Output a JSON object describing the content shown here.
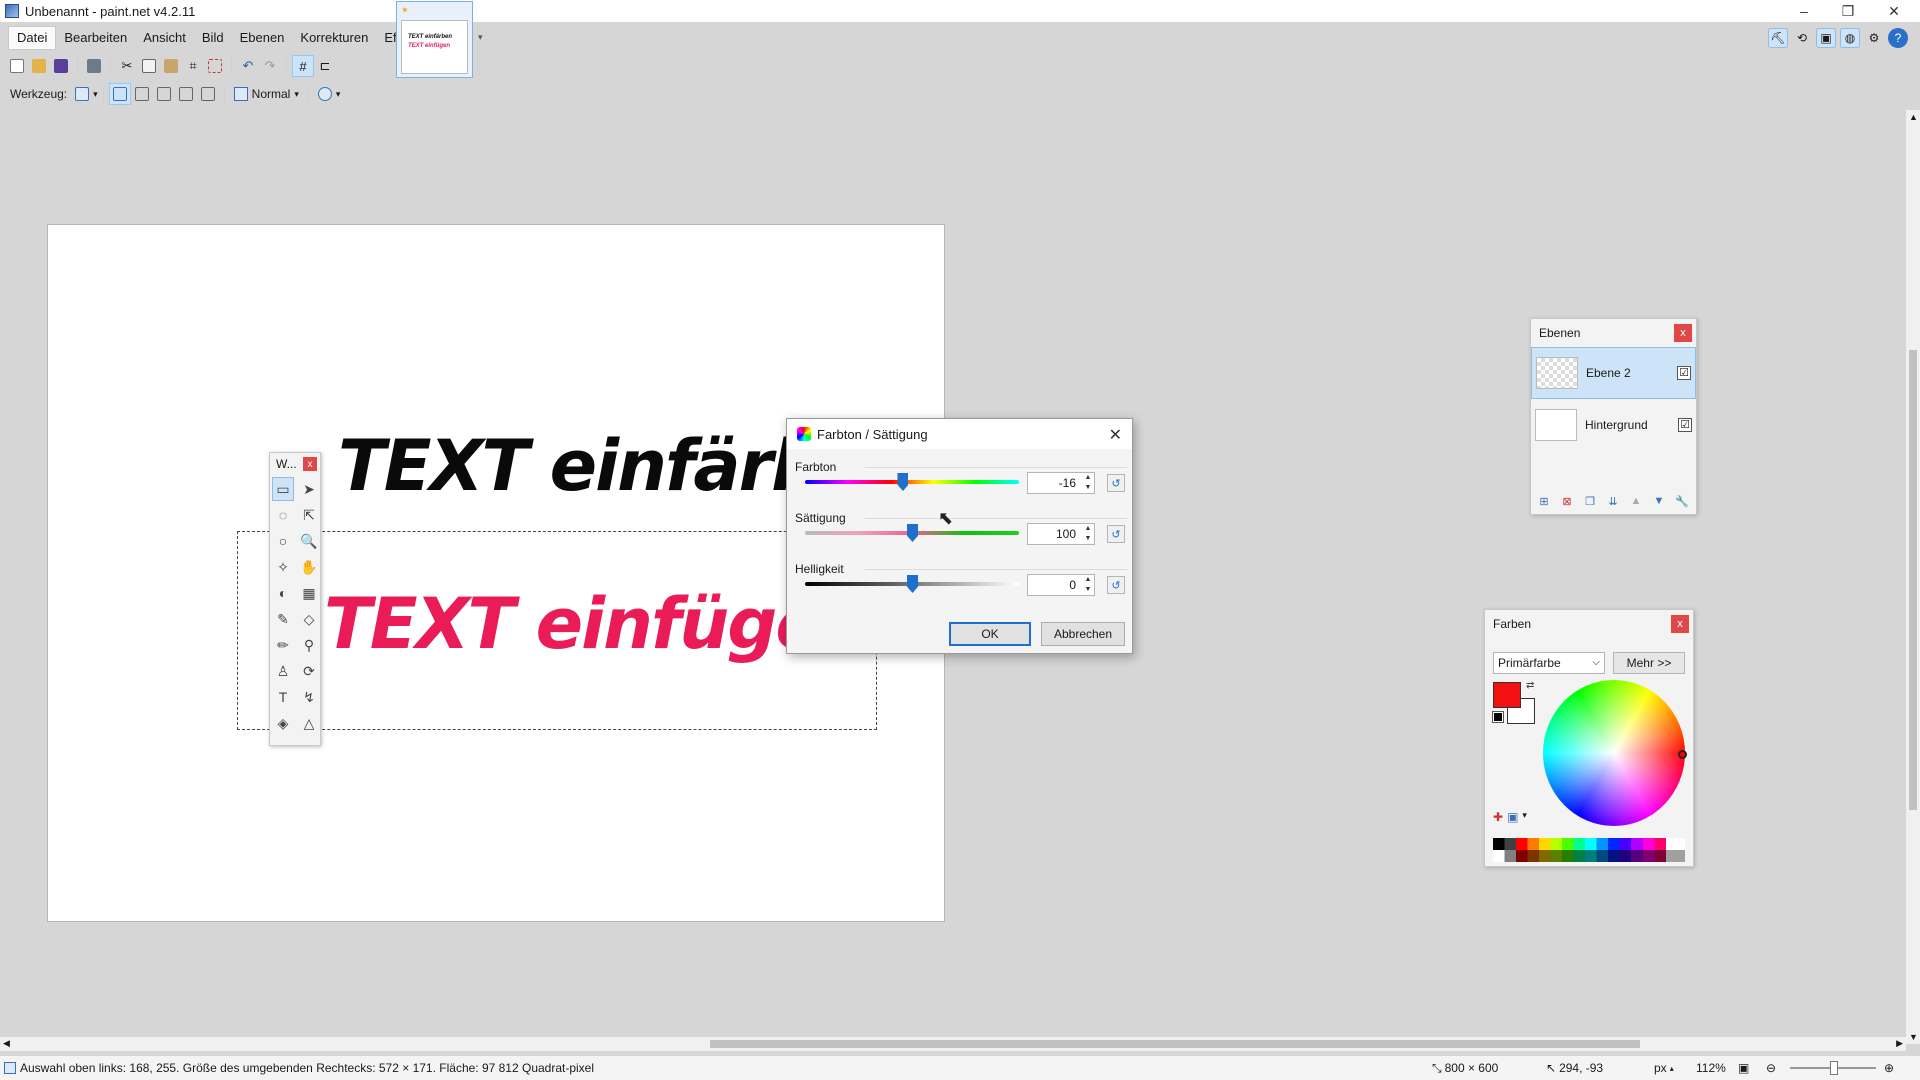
{
  "window": {
    "title": "Unbenannt - paint.net v4.2.11",
    "minimize": "–",
    "maximize": "❐",
    "close": "✕"
  },
  "menu": [
    "Datei",
    "Bearbeiten",
    "Ansicht",
    "Bild",
    "Ebenen",
    "Korrekturen",
    "Effekte"
  ],
  "image_tab": {
    "thumb_line1": "TEXT einfärben",
    "thumb_line2": "TEXT einfügen"
  },
  "toolbar2": {
    "tool_label": "Werkzeug:",
    "blend_mode": "Normal"
  },
  "canvas": {
    "text_line1": "TEXT einfärb",
    "text_line2": "TEXT einfüge"
  },
  "tools_window": {
    "title": "W...",
    "close": "x"
  },
  "dialog": {
    "title": "Farbton / Sättigung",
    "close": "✕",
    "hue": {
      "label": "Farbton",
      "value": "-16",
      "min": -180,
      "max": 180
    },
    "saturation": {
      "label": "Sättigung",
      "value": "100",
      "min": 0,
      "max": 200
    },
    "brightness": {
      "label": "Helligkeit",
      "value": "0",
      "min": -100,
      "max": 100
    },
    "ok": "OK",
    "cancel": "Abbrechen"
  },
  "layers": {
    "title": "Ebenen",
    "close": "x",
    "items": [
      {
        "name": "Ebene 2",
        "visible": "☑"
      },
      {
        "name": "Hintergrund",
        "visible": "☑"
      }
    ]
  },
  "colors": {
    "title": "Farben",
    "close": "x",
    "select_value": "Primärfarbe",
    "more": "Mehr >>",
    "primary": "#f21010",
    "secondary": "#ffffff"
  },
  "status": {
    "selection_info": "Auswahl oben links: 168, 255. Größe des umgebenden Rechtecks: 572 × 171. Fläche: 97 812 Quadrat-pixel",
    "image_size": "800 × 600",
    "cursor_pos": "294, -93",
    "unit": "px",
    "zoom": "112%"
  }
}
